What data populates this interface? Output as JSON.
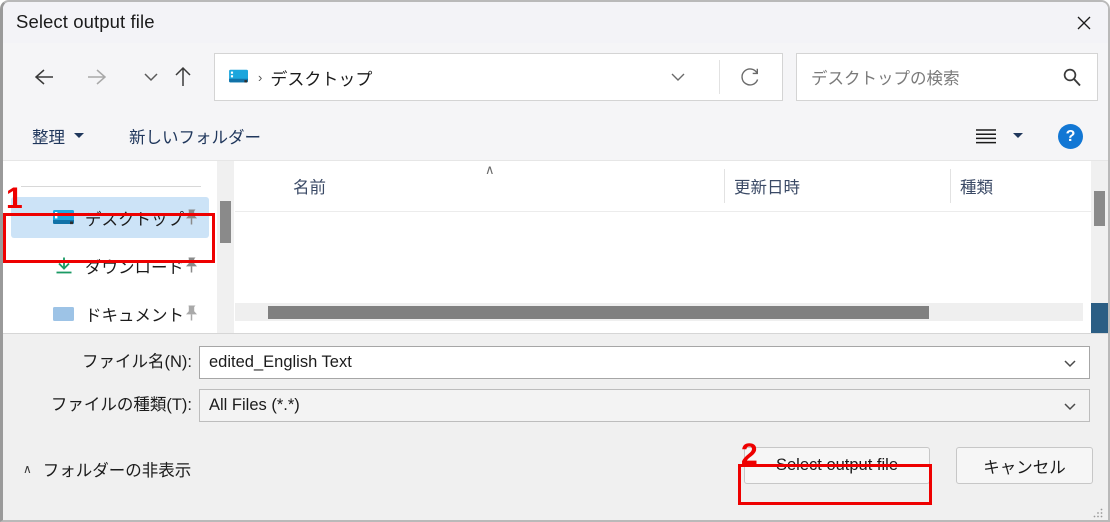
{
  "window": {
    "title": "Select output file",
    "close_icon": "close-icon"
  },
  "navbar": {
    "back_icon": "arrow-left-icon",
    "forward_icon": "arrow-right-icon",
    "recent_icon": "chevron-down-icon",
    "up_icon": "arrow-up-icon",
    "address": {
      "folder_icon": "desktop-icon",
      "separator": "›",
      "path": "デスクトップ",
      "chevron_icon": "chevron-down-icon",
      "refresh_icon": "refresh-icon"
    },
    "search": {
      "placeholder": "デスクトップの検索",
      "icon": "search-icon"
    }
  },
  "commandbar": {
    "organize_label": "整理",
    "new_folder_label": "新しいフォルダー",
    "view_icon": "view-list-icon",
    "help_label": "?",
    "help_icon": "help-icon"
  },
  "sidebar": {
    "items": [
      {
        "label": "デスクトップ",
        "icon": "desktop-icon",
        "pinned": true,
        "selected": true
      },
      {
        "label": "ダウンロード",
        "icon": "download-icon",
        "pinned": true,
        "selected": false
      },
      {
        "label": "ドキュメント",
        "icon": "documents-icon",
        "pinned": true,
        "selected": false
      }
    ]
  },
  "filelist": {
    "columns": [
      {
        "label": "名前",
        "sorted": "asc"
      },
      {
        "label": "更新日時",
        "sorted": ""
      },
      {
        "label": "種類",
        "sorted": ""
      }
    ],
    "sort_caret": "∧",
    "rows": []
  },
  "form": {
    "filename_label": "ファイル名(N):",
    "filename_value": "edited_English Text",
    "filetype_label": "ファイルの種類(T):",
    "filetype_value": "All Files (*.*)",
    "chevron_icon": "chevron-down-icon"
  },
  "footer": {
    "folder_toggle_label": "フォルダーの非表示",
    "folder_toggle_caret": "∧",
    "primary_button": "Select output file",
    "cancel_button": "キャンセル"
  },
  "annotations": [
    {
      "number": "1",
      "target": "sidebar-item-desktop"
    },
    {
      "number": "2",
      "target": "select-output-file-button"
    }
  ],
  "colors": {
    "titlebar": "#f3f3f7",
    "chrome": "#f5f5f7",
    "selection": "#cce3f7",
    "command_text": "#20375c",
    "help_blue": "#1277d4",
    "annotation_red": "#ee0000",
    "scrollbar_thumb": "#8a8a8a"
  }
}
